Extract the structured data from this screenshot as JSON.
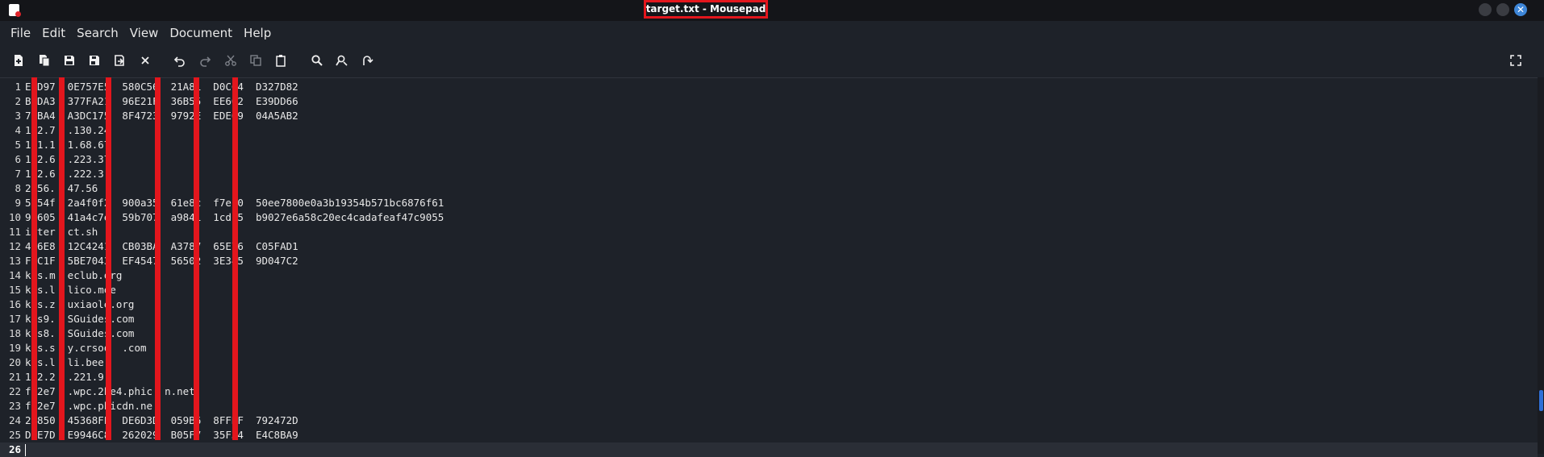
{
  "window": {
    "title": "target.txt - Mousepad"
  },
  "menu": [
    {
      "label": "File"
    },
    {
      "label": "Edit"
    },
    {
      "label": "Search"
    },
    {
      "label": "View"
    },
    {
      "label": "Document"
    },
    {
      "label": "Help"
    }
  ],
  "toolbar": {
    "icons": [
      "new-document-icon",
      "new-window-icon",
      "save-icon",
      "save-as-icon",
      "reload-icon",
      "close-tab-icon",
      "undo-icon",
      "redo-icon",
      "cut-icon",
      "copy-icon",
      "paste-icon",
      "find-icon",
      "find-replace-icon",
      "go-to-line-icon",
      "fullscreen-icon"
    ],
    "close_glyph": "✕"
  },
  "editor": {
    "current_line": 26,
    "lines": [
      {
        "n": "1",
        "text": "E D97  0E757E5  580C56  21A81  D0CC4  D327D82"
      },
      {
        "n": "2",
        "text": "B DA3  377FA21  96E21F  36B55  EE602  E39DD66"
      },
      {
        "n": "3",
        "text": "7 BA4  A3DC175  8F4723  9792E  EDE09  04A5AB2"
      },
      {
        "n": "4",
        "text": "1 2.7  .130.24"
      },
      {
        "n": "5",
        "text": "1 1.1  1.68.67"
      },
      {
        "n": "6",
        "text": "1 2.6  .223.37"
      },
      {
        "n": "7",
        "text": "1 2.6  .222.3"
      },
      {
        "n": "8",
        "text": "2 56.  47.56"
      },
      {
        "n": "9",
        "text": "5 54f  2a4f0f2  900a35  61e8c  f7ef0  50ee7800e0a3b19354b571bc6876f61"
      },
      {
        "n": "10",
        "text": "9 605  41a4c7e  59b707  a9841  1cd15  b9027e6a58c20ec4cadafeaf47c9055"
      },
      {
        "n": "11",
        "text": "i ter  ct.sh"
      },
      {
        "n": "12",
        "text": "4 6E8  12C4241  CB03BA  A3787  65E76  C05FAD1"
      },
      {
        "n": "13",
        "text": "F C1F  5BE7043  EF4547  56502  3E345  9D047C2"
      },
      {
        "n": "14",
        "text": "k s.m  eclub.org"
      },
      {
        "n": "15",
        "text": "k s.l  lico.moe"
      },
      {
        "n": "16",
        "text": "k s.z  uxiaole.org"
      },
      {
        "n": "17",
        "text": "k s9.  SGuides.com"
      },
      {
        "n": "18",
        "text": "k s8.  SGuides.com"
      },
      {
        "n": "19",
        "text": "k s.s  y.crsoo  .com"
      },
      {
        "n": "20",
        "text": "k s.l  li.beer"
      },
      {
        "n": "21",
        "text": "1 2.2  .221.9"
      },
      {
        "n": "22",
        "text": "f 2e7  .wpc.2be4.phic  n.net"
      },
      {
        "n": "23",
        "text": "f 2e7  .wpc.phicdn.ne"
      },
      {
        "n": "24",
        "text": "2 850  45368FE  DE6D3D  059B6  8FFBF  792472D"
      },
      {
        "n": "25",
        "text": "D E7D  E9946C8  262029  B05F7  35F34  E4C8BA9"
      },
      {
        "n": "26",
        "text": ""
      }
    ]
  },
  "colors": {
    "background": "#1e2229",
    "annotation_red": "#e3161d",
    "scroll_thumb": "#2f6fd6"
  }
}
